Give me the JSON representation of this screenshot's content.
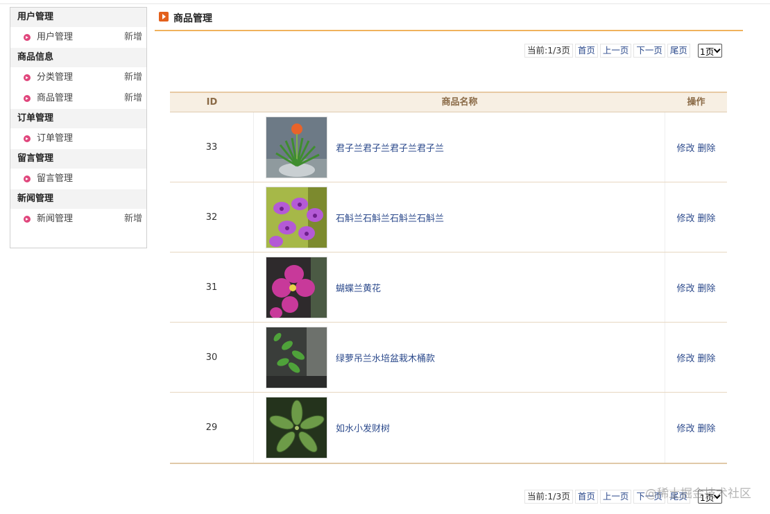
{
  "sidebar": {
    "sections": [
      {
        "title": "用户管理",
        "items": [
          {
            "label": "用户管理",
            "add": "新增"
          }
        ]
      },
      {
        "title": "商品信息",
        "items": [
          {
            "label": "分类管理",
            "add": "新增"
          },
          {
            "label": "商品管理",
            "add": "新增"
          }
        ]
      },
      {
        "title": "订单管理",
        "items": [
          {
            "label": "订单管理",
            "add": ""
          }
        ]
      },
      {
        "title": "留言管理",
        "items": [
          {
            "label": "留言管理",
            "add": ""
          }
        ]
      },
      {
        "title": "新闻管理",
        "items": [
          {
            "label": "新闻管理",
            "add": "新增"
          }
        ]
      }
    ]
  },
  "header": {
    "title": "商品管理"
  },
  "pagination": {
    "current": "当前:1/3页",
    "first": "首页",
    "prev": "上一页",
    "next": "下一页",
    "last": "尾页",
    "select_value": "1页"
  },
  "table": {
    "headers": {
      "id": "ID",
      "name": "商品名称",
      "op": "操作"
    },
    "rows": [
      {
        "id": "33",
        "name": "君子兰君子兰君子兰君子兰",
        "image": "clivia-image",
        "edit": "修改",
        "delete": "删除"
      },
      {
        "id": "32",
        "name": "石斛兰石斛兰石斛兰石斛兰",
        "image": "dendrobium-image",
        "edit": "修改",
        "delete": "删除"
      },
      {
        "id": "31",
        "name": "蝴蝶兰黄花",
        "image": "phalaenopsis-image",
        "edit": "修改",
        "delete": "删除"
      },
      {
        "id": "30",
        "name": "绿萝吊兰水培盆栽木桶款",
        "image": "pothos-image",
        "edit": "修改",
        "delete": "删除"
      },
      {
        "id": "29",
        "name": "如水小发财树",
        "image": "money-tree-image",
        "edit": "修改",
        "delete": "删除"
      }
    ]
  },
  "watermark": "@稀土掘金技术社区"
}
